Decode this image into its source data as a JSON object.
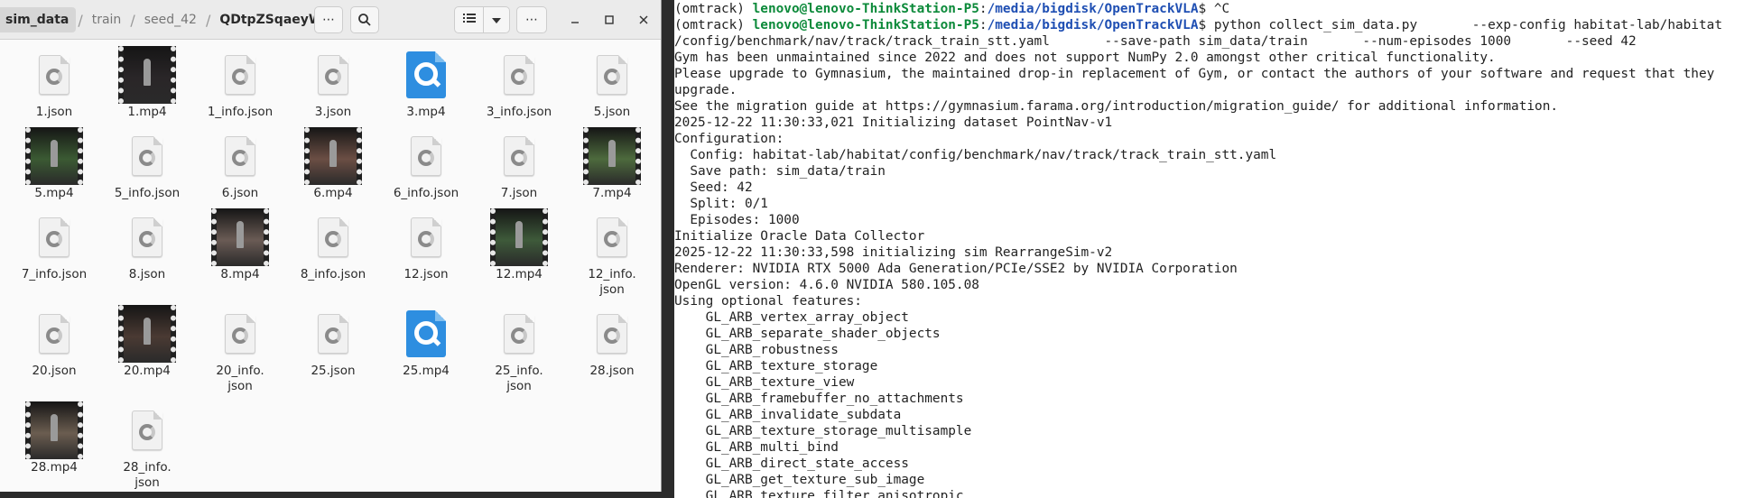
{
  "file_manager": {
    "breadcrumbs": [
      "sim_data",
      "train",
      "seed_42",
      "QDtpZSqaeyW"
    ],
    "separator": "/",
    "icons": {
      "more": "more-horizontal-icon",
      "search": "search-icon",
      "list_view": "list-view-icon",
      "dropdown": "chevron-down-icon",
      "menu": "hamburger-more-icon",
      "minimize": "minimize-icon",
      "maximize": "maximize-icon",
      "close": "close-icon"
    },
    "files": [
      {
        "name": "1.json",
        "kind": "json"
      },
      {
        "name": "1.mp4",
        "kind": "video",
        "tint": "#2a2628"
      },
      {
        "name": "1_info.json",
        "kind": "json"
      },
      {
        "name": "3.json",
        "kind": "json"
      },
      {
        "name": "3.mp4",
        "kind": "qt"
      },
      {
        "name": "3_info.json",
        "kind": "json"
      },
      {
        "name": "5.json",
        "kind": "json"
      },
      {
        "name": "5.mp4",
        "kind": "video",
        "tint": "#3b5a33"
      },
      {
        "name": "5_info.json",
        "kind": "json"
      },
      {
        "name": "6.json",
        "kind": "json"
      },
      {
        "name": "6.mp4",
        "kind": "video",
        "tint": "#6b4e44"
      },
      {
        "name": "6_info.json",
        "kind": "json"
      },
      {
        "name": "7.json",
        "kind": "json"
      },
      {
        "name": "7.mp4",
        "kind": "video",
        "tint": "#4d6a3d"
      },
      {
        "name": "7_info.json",
        "kind": "json"
      },
      {
        "name": "8.json",
        "kind": "json"
      },
      {
        "name": "8.mp4",
        "kind": "video",
        "tint": "#6a5b55"
      },
      {
        "name": "8_info.json",
        "kind": "json"
      },
      {
        "name": "12.json",
        "kind": "json"
      },
      {
        "name": "12.mp4",
        "kind": "video",
        "tint": "#3e5a3a"
      },
      {
        "name": "12_info.\njson",
        "kind": "json"
      },
      {
        "name": "20.json",
        "kind": "json"
      },
      {
        "name": "20.mp4",
        "kind": "video",
        "tint": "#4a3a33"
      },
      {
        "name": "20_info.\njson",
        "kind": "json"
      },
      {
        "name": "25.json",
        "kind": "json"
      },
      {
        "name": "25.mp4",
        "kind": "qt"
      },
      {
        "name": "25_info.\njson",
        "kind": "json"
      },
      {
        "name": "28.json",
        "kind": "json"
      },
      {
        "name": "28.mp4",
        "kind": "video",
        "tint": "#6b5d50"
      },
      {
        "name": "28_info.\njson",
        "kind": "json"
      }
    ]
  },
  "terminal": {
    "lines": [
      {
        "env": "(omtrack) ",
        "user": "lenovo@lenovo-ThinkStation-P5",
        "sep": ":",
        "path": "/media/bigdisk/OpenTrackVLA",
        "cmd": "$ ^C"
      },
      {
        "env": "(omtrack) ",
        "user": "lenovo@lenovo-ThinkStation-P5",
        "sep": ":",
        "path": "/media/bigdisk/OpenTrackVLA",
        "cmd": "$ python collect_sim_data.py       --exp-config habitat-lab/habitat"
      },
      {
        "text": "/config/benchmark/nav/track/track_train_stt.yaml       --save-path sim_data/train       --num-episodes 1000       --seed 42"
      },
      {
        "text": "Gym has been unmaintained since 2022 and does not support NumPy 2.0 amongst other critical functionality."
      },
      {
        "text": "Please upgrade to Gymnasium, the maintained drop-in replacement of Gym, or contact the authors of your software and request that they"
      },
      {
        "text": "upgrade."
      },
      {
        "text": "See the migration guide at https://gymnasium.farama.org/introduction/migration_guide/ for additional information."
      },
      {
        "text": "2025-12-22 11:30:33,021 Initializing dataset PointNav-v1"
      },
      {
        "text": "Configuration:"
      },
      {
        "text": "  Config: habitat-lab/habitat/config/benchmark/nav/track/track_train_stt.yaml"
      },
      {
        "text": "  Save path: sim_data/train"
      },
      {
        "text": "  Seed: 42"
      },
      {
        "text": "  Split: 0/1"
      },
      {
        "text": "  Episodes: 1000"
      },
      {
        "text": "Initialize Oracle Data Collector"
      },
      {
        "text": "2025-12-22 11:30:33,598 initializing sim RearrangeSim-v2"
      },
      {
        "text": "Renderer: NVIDIA RTX 5000 Ada Generation/PCIe/SSE2 by NVIDIA Corporation"
      },
      {
        "text": "OpenGL version: 4.6.0 NVIDIA 580.105.08"
      },
      {
        "text": "Using optional features:"
      },
      {
        "text": "    GL_ARB_vertex_array_object"
      },
      {
        "text": "    GL_ARB_separate_shader_objects"
      },
      {
        "text": "    GL_ARB_robustness"
      },
      {
        "text": "    GL_ARB_texture_storage"
      },
      {
        "text": "    GL_ARB_texture_view"
      },
      {
        "text": "    GL_ARB_framebuffer_no_attachments"
      },
      {
        "text": "    GL_ARB_invalidate_subdata"
      },
      {
        "text": "    GL_ARB_texture_storage_multisample"
      },
      {
        "text": "    GL_ARB_multi_bind"
      },
      {
        "text": "    GL_ARB_direct_state_access"
      },
      {
        "text": "    GL_ARB_get_texture_sub_image"
      },
      {
        "text": "    GL_ARB_texture_filter_anisotropic"
      }
    ]
  },
  "colors": {
    "terminal_user": "#0c8a3a",
    "terminal_path": "#1f4fb3",
    "qt_icon": "#2e8ee0"
  }
}
